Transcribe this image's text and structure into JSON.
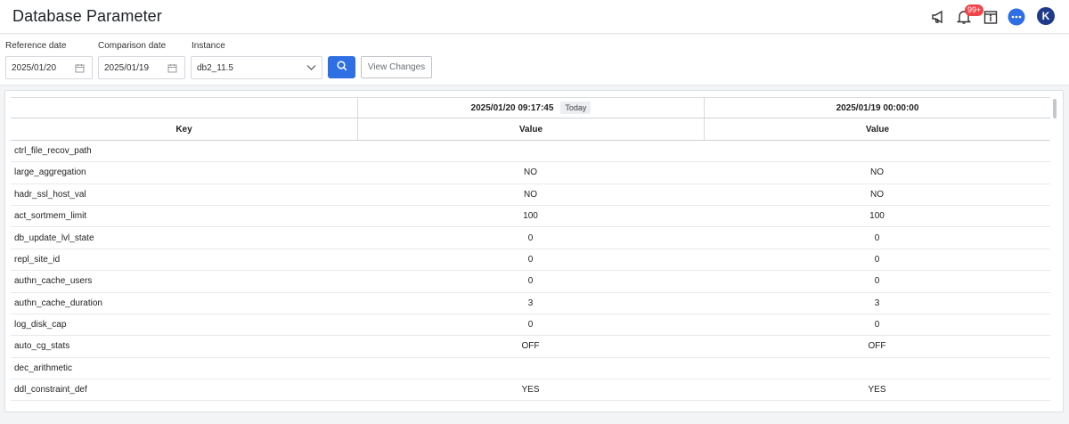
{
  "header": {
    "title": "Database Parameter",
    "icons": [
      "megaphone-icon",
      "bell-icon",
      "notice-icon",
      "chat-icon"
    ],
    "notification_badge": "99+",
    "avatar_initial": "K",
    "accent_color": "#2f6fe4"
  },
  "filters": {
    "reference_date_label": "Reference date",
    "reference_date_value": "2025/01/20",
    "comparison_date_label": "Comparison date",
    "comparison_date_value": "2025/01/19",
    "instance_label": "Instance",
    "instance_value": "db2_11.5",
    "view_changes_label": "View Changes"
  },
  "table": {
    "reference_timestamp": "2025/01/20 09:17:45",
    "today_tag": "Today",
    "comparison_timestamp": "2025/01/19 00:00:00",
    "col_key": "Key",
    "col_value_ref": "Value",
    "col_value_cmp": "Value",
    "rows": [
      {
        "key": "ctrl_file_recov_path",
        "ref": "",
        "cmp": ""
      },
      {
        "key": "large_aggregation",
        "ref": "NO",
        "cmp": "NO"
      },
      {
        "key": "hadr_ssl_host_val",
        "ref": "NO",
        "cmp": "NO"
      },
      {
        "key": "act_sortmem_limit",
        "ref": "100",
        "cmp": "100"
      },
      {
        "key": "db_update_lvl_state",
        "ref": "0",
        "cmp": "0"
      },
      {
        "key": "repl_site_id",
        "ref": "0",
        "cmp": "0"
      },
      {
        "key": "authn_cache_users",
        "ref": "0",
        "cmp": "0"
      },
      {
        "key": "authn_cache_duration",
        "ref": "3",
        "cmp": "3"
      },
      {
        "key": "log_disk_cap",
        "ref": "0",
        "cmp": "0"
      },
      {
        "key": "auto_cg_stats",
        "ref": "OFF",
        "cmp": "OFF"
      },
      {
        "key": "dec_arithmetic",
        "ref": "",
        "cmp": ""
      },
      {
        "key": "ddl_constraint_def",
        "ref": "YES",
        "cmp": "YES"
      }
    ]
  }
}
